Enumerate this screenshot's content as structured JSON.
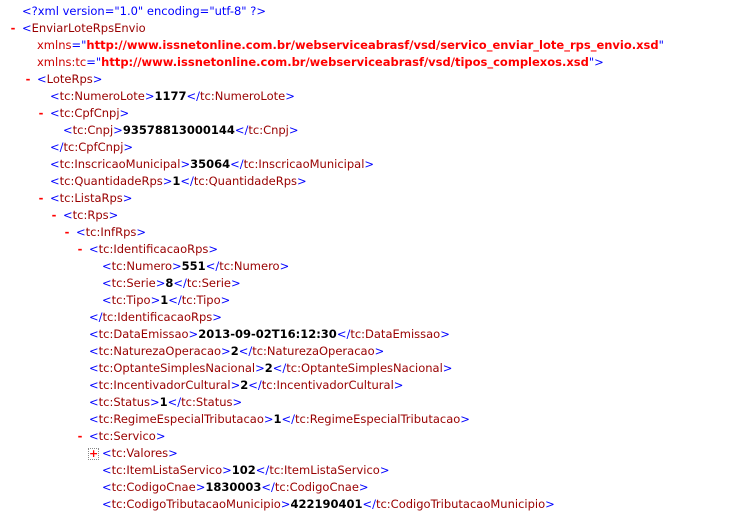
{
  "document": {
    "lines": [
      {
        "kind": "pi",
        "level": 0,
        "text": "<?xml version=\"1.0\" encoding=\"utf-8\" ?>"
      },
      {
        "kind": "open-attrs",
        "level": 0,
        "toggle": "-",
        "tag": "EnviarLoteRpsEnvio"
      },
      {
        "kind": "attr",
        "level": 1,
        "name": "xmlns",
        "value": "http://www.issnetonline.com.br/webserviceabrasf/vsd/servico_enviar_lote_rps_envio.xsd",
        "end": ""
      },
      {
        "kind": "attr",
        "level": 1,
        "name": "xmlns:tc",
        "value": "http://www.issnetonline.com.br/webserviceabrasf/vsd/tipos_complexos.xsd",
        "end": ">"
      },
      {
        "kind": "open",
        "level": 1,
        "toggle": "-",
        "tag": "LoteRps"
      },
      {
        "kind": "leaf",
        "level": 2,
        "tag": "tc:NumeroLote",
        "value": "1177"
      },
      {
        "kind": "open",
        "level": 2,
        "toggle": "-",
        "tag": "tc:CpfCnpj"
      },
      {
        "kind": "leaf",
        "level": 3,
        "tag": "tc:Cnpj",
        "value": "93578813000144"
      },
      {
        "kind": "close",
        "level": 2,
        "tag": "tc:CpfCnpj"
      },
      {
        "kind": "leaf",
        "level": 2,
        "tag": "tc:InscricaoMunicipal",
        "value": "35064"
      },
      {
        "kind": "leaf",
        "level": 2,
        "tag": "tc:QuantidadeRps",
        "value": "1"
      },
      {
        "kind": "open",
        "level": 2,
        "toggle": "-",
        "tag": "tc:ListaRps"
      },
      {
        "kind": "open",
        "level": 3,
        "toggle": "-",
        "tag": "tc:Rps"
      },
      {
        "kind": "open",
        "level": 4,
        "toggle": "-",
        "tag": "tc:InfRps"
      },
      {
        "kind": "open",
        "level": 5,
        "toggle": "-",
        "tag": "tc:IdentificacaoRps"
      },
      {
        "kind": "leaf",
        "level": 6,
        "tag": "tc:Numero",
        "value": "551"
      },
      {
        "kind": "leaf",
        "level": 6,
        "tag": "tc:Serie",
        "value": "8"
      },
      {
        "kind": "leaf",
        "level": 6,
        "tag": "tc:Tipo",
        "value": "1"
      },
      {
        "kind": "close",
        "level": 5,
        "tag": "tc:IdentificacaoRps"
      },
      {
        "kind": "leaf",
        "level": 5,
        "tag": "tc:DataEmissao",
        "value": "2013-09-02T16:12:30"
      },
      {
        "kind": "leaf",
        "level": 5,
        "tag": "tc:NaturezaOperacao",
        "value": "2"
      },
      {
        "kind": "leaf",
        "level": 5,
        "tag": "tc:OptanteSimplesNacional",
        "value": "2"
      },
      {
        "kind": "leaf",
        "level": 5,
        "tag": "tc:IncentivadorCultural",
        "value": "2"
      },
      {
        "kind": "leaf",
        "level": 5,
        "tag": "tc:Status",
        "value": "1"
      },
      {
        "kind": "leaf",
        "level": 5,
        "tag": "tc:RegimeEspecialTributacao",
        "value": "1"
      },
      {
        "kind": "open",
        "level": 5,
        "toggle": "-",
        "tag": "tc:Servico"
      },
      {
        "kind": "open",
        "level": 6,
        "toggle": "+",
        "tag": "tc:Valores"
      },
      {
        "kind": "leaf",
        "level": 6,
        "tag": "tc:ItemListaServico",
        "value": "102"
      },
      {
        "kind": "leaf",
        "level": 6,
        "tag": "tc:CodigoCnae",
        "value": "1830003"
      },
      {
        "kind": "leaf",
        "level": 6,
        "tag": "tc:CodigoTributacaoMunicipio",
        "value": "422190401"
      }
    ]
  }
}
